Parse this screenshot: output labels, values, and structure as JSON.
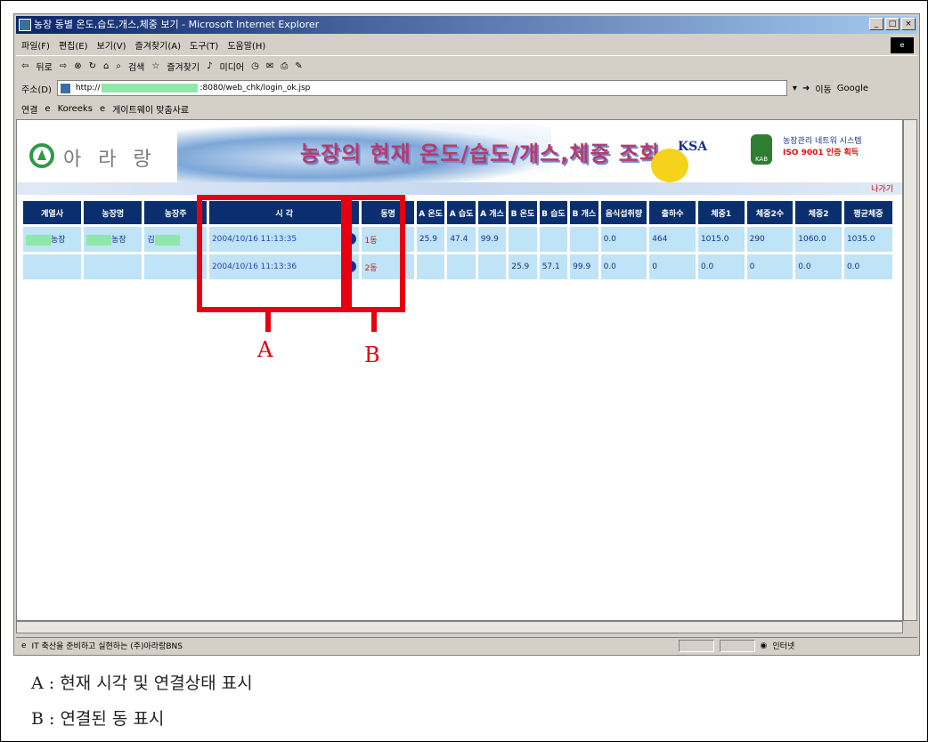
{
  "window": {
    "title": "농장 동별 온도,습도,개스,체중 보기 - Microsoft Internet Explorer",
    "buttons": [
      "_",
      "□",
      "×"
    ]
  },
  "menu": [
    "파일(F)",
    "편집(E)",
    "보기(V)",
    "즐겨찾기(A)",
    "도구(T)",
    "도움말(H)"
  ],
  "toolbar": {
    "back": "뒤로",
    "search": "검색",
    "favorites": "즐겨찾기",
    "media": "미디어"
  },
  "address": {
    "label": "주소(D)",
    "url_prefix": "http://",
    "url_suffix": ":8080/web_chk/login_ok.jsp",
    "go": "이동",
    "google": "Google"
  },
  "links": {
    "label": "연결",
    "items": [
      "Koreeks",
      "게이트웨이 맞춤사료"
    ]
  },
  "banner": {
    "brand": "아 라 랑",
    "title": "농장의 현재 온도/습도/개스,체중 조회",
    "ksa": "KSA",
    "kab": "KAB",
    "iso_line1": "농장관리 네트워 시스템",
    "iso_line2": "ISO 9001 인증 획득",
    "logout": "나가기"
  },
  "table": {
    "headers": [
      "계열사",
      "농장명",
      "농장주",
      "시 각",
      "동명",
      "A 온도",
      "A 습도",
      "A 개스",
      "B 온도",
      "B 습도",
      "B 개스",
      "음식섭취량",
      "출하수",
      "체중1",
      "체중2수",
      "체중2",
      "평균체중"
    ],
    "rows": [
      {
        "affiliate_suffix": "농장",
        "farm": "농장",
        "owner": "김",
        "time": "2004/10/16 11:13:35",
        "dong": "1동",
        "a_temp": "25.9",
        "a_hum": "47.4",
        "a_gas": "99.9",
        "b_temp": "",
        "b_hum": "",
        "b_gas": "",
        "intake": "0.0",
        "ship": "464",
        "w1": "1015.0",
        "w2cnt": "290",
        "w2": "1060.0",
        "avg": "1035.0"
      },
      {
        "affiliate_suffix": "",
        "farm": "",
        "owner": "",
        "time": "2004/10/16 11:13:36",
        "dong": "2동",
        "a_temp": "",
        "a_hum": "",
        "a_gas": "",
        "b_temp": "25.9",
        "b_hum": "57.1",
        "b_gas": "99.9",
        "intake": "0.0",
        "ship": "0",
        "w1": "0.0",
        "w2cnt": "0",
        "w2": "0.0",
        "avg": "0.0"
      }
    ]
  },
  "status": {
    "text": "IT 축산을 준비하고 실현하는 (주)아라랑BNS",
    "zone": "인터넷"
  },
  "annotations": {
    "a_label": "A",
    "b_label": "B",
    "a_desc": "A : 현재 시각 및 연결상태 표시",
    "b_desc": "B : 연결된 동 표시"
  }
}
